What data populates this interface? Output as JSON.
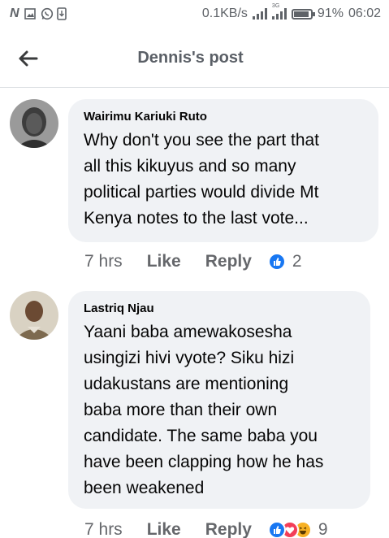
{
  "status_bar": {
    "network_speed": "0.1KB/s",
    "network_type": "3G",
    "battery": "91%",
    "battery_level": 0.91,
    "time": "06:02",
    "icons": [
      "n-icon",
      "gallery-icon",
      "whatsapp-icon",
      "download-icon",
      "signal-icon",
      "signal-3g-icon",
      "battery-icon"
    ]
  },
  "header": {
    "title": "Dennis's post",
    "back_icon": "back-arrow-icon"
  },
  "comments": [
    {
      "author": "Wairimu Kariuki Ruto",
      "text_lines": [
        "Why don't you see the part that",
        "all this kikuyus and so many",
        "political parties would divide Mt",
        "Kenya notes to the last vote..."
      ],
      "time": "7 hrs",
      "like_label": "Like",
      "reply_label": "Reply",
      "reaction_count": "2",
      "reactions": [
        "like-reaction-icon"
      ]
    },
    {
      "author": "Lastriq Njau",
      "text_lines": [
        "Yaani baba amewakosesha",
        "usingizi hivi vyote? Siku hizi",
        "udakustans are mentioning",
        "baba more than their own",
        "candidate. The same baba you",
        "have been clapping how he has",
        "been weakened"
      ],
      "time": "7 hrs",
      "like_label": "Like",
      "reply_label": "Reply",
      "reaction_count": "9",
      "reactions": [
        "like-reaction-icon",
        "love-reaction-icon",
        "haha-reaction-icon"
      ]
    }
  ],
  "colors": {
    "bubble": "#f0f2f5",
    "meta_text": "#65676b",
    "like_blue": "#1877f2",
    "love_red": "#f33e58",
    "haha_yellow": "#f7b125"
  }
}
